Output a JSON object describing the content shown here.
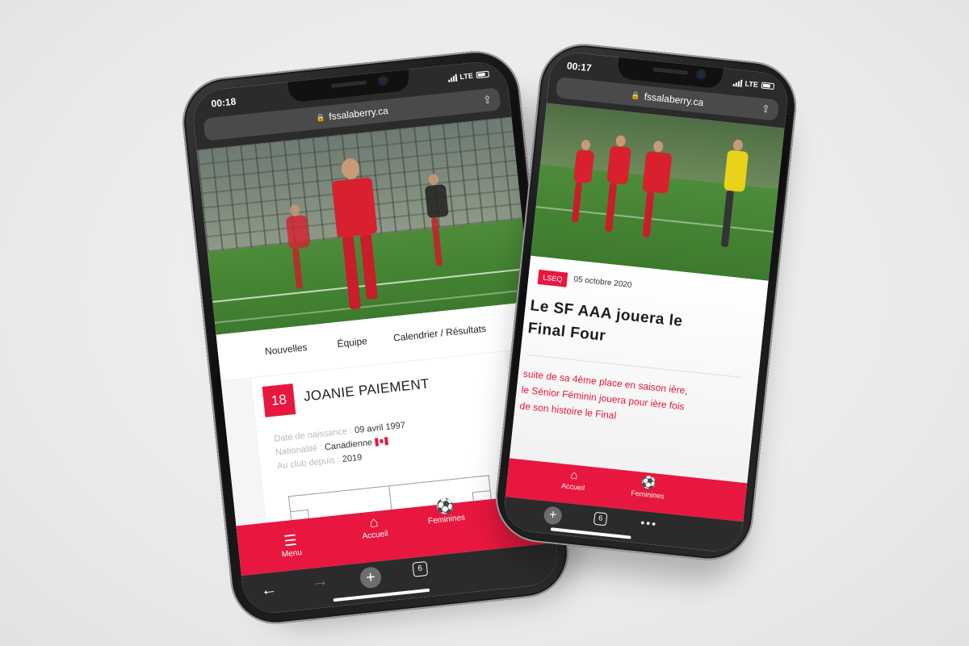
{
  "left_phone": {
    "status": {
      "time": "00:18",
      "network": "LTE"
    },
    "browser": {
      "url": "fssalaberry.ca"
    },
    "site_nav": {
      "items": [
        "Nouvelles",
        "Équipe",
        "Calendrier / Résultats"
      ]
    },
    "player": {
      "number": "18",
      "name": "JOANIE PAIEMENT",
      "details": [
        {
          "label": "Date de naissance :",
          "value": "09 avril 1997"
        },
        {
          "label": "Nationalité :",
          "value": "Canadienne"
        },
        {
          "label": "Au club depuis :",
          "value": "2019"
        }
      ],
      "flag_icon": "canada-flag-icon"
    },
    "bottom_nav": {
      "menu": "Menu",
      "home": "Accueil",
      "women": "Feminines"
    },
    "toolbar": {
      "tabs_count": "6"
    }
  },
  "right_phone": {
    "status": {
      "time": "00:17",
      "network": "LTE"
    },
    "browser": {
      "url": "fssalaberry.ca"
    },
    "article": {
      "tag": "LSEQ",
      "date": "05 octobre 2020",
      "title": "Le SF AAA jouera le Final Four",
      "excerpt": "suite de sa 4ème place en saison ière, le Sénior Féminin jouera pour ière fois de son histoire le Final"
    },
    "bottom_nav": {
      "home": "Accueil",
      "women": "Feminines"
    },
    "toolbar": {
      "tabs_count": "6"
    }
  },
  "colors": {
    "brand_red": "#e8173f",
    "browser_dark": "#2b2b2b"
  }
}
